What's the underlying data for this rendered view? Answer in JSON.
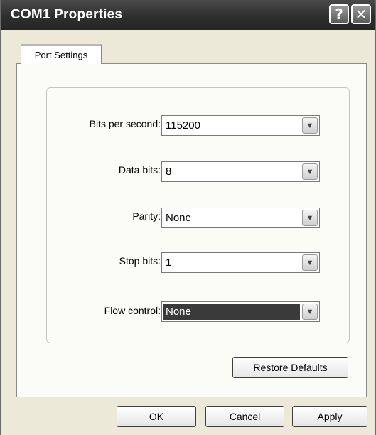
{
  "window": {
    "title": "COM1 Properties",
    "help_glyph": "?",
    "close_glyph": "✕"
  },
  "tabs": [
    {
      "label": "Port Settings",
      "active": true
    }
  ],
  "fields": [
    {
      "label": "Bits per second:",
      "value": "115200"
    },
    {
      "label": "Data bits:",
      "value": "8"
    },
    {
      "label": "Parity:",
      "value": "None"
    },
    {
      "label": "Stop bits:",
      "value": "1"
    },
    {
      "label": "Flow control:",
      "value": "None",
      "selected": true
    }
  ],
  "dropdown_arrow_glyph": "▼",
  "buttons": {
    "restore_defaults": "Restore Defaults",
    "ok": "OK",
    "cancel": "Cancel",
    "apply": "Apply"
  },
  "icons": {
    "help": "help-icon",
    "close": "close-icon",
    "dropdown": "chevron-down-icon"
  },
  "colors": {
    "titlebar": "#2e2e2e",
    "window_bg": "#ece9d8",
    "selection": "#3a3a3a"
  }
}
